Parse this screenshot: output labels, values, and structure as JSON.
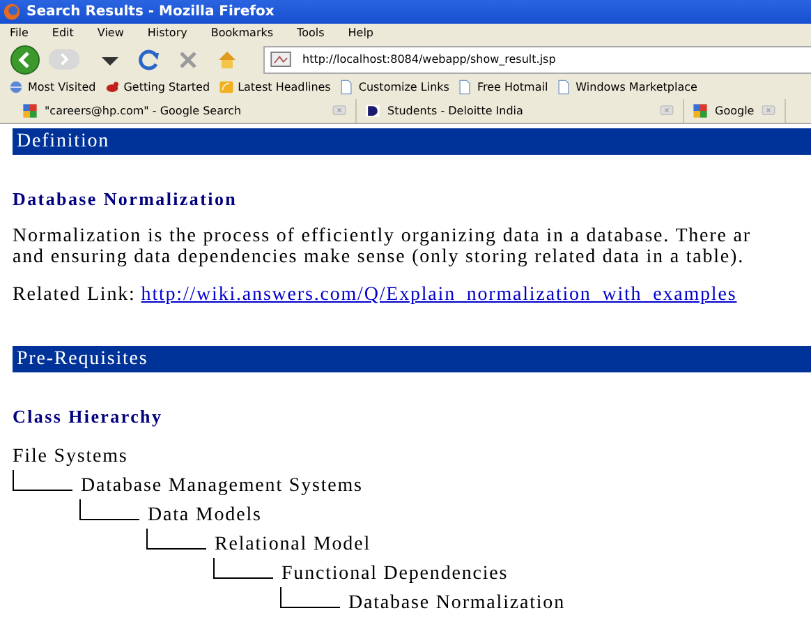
{
  "window": {
    "title": "Search Results - Mozilla Firefox"
  },
  "menu": [
    "File",
    "Edit",
    "View",
    "History",
    "Bookmarks",
    "Tools",
    "Help"
  ],
  "address": {
    "value": "http://localhost:8084/webapp/show_result.jsp"
  },
  "bookmarks": [
    {
      "label": "Most Visited",
      "kind": "globe"
    },
    {
      "label": "Getting Started",
      "kind": "bird"
    },
    {
      "label": "Latest Headlines",
      "kind": "feed"
    },
    {
      "label": "Customize Links",
      "kind": "page"
    },
    {
      "label": "Free Hotmail",
      "kind": "page"
    },
    {
      "label": "Windows Marketplace",
      "kind": "page"
    }
  ],
  "tabs": [
    {
      "label": "\"careers@hp.com\" - Google Search",
      "kind": "google"
    },
    {
      "label": "Students - Deloitte India",
      "kind": "deloitte"
    },
    {
      "label": "Google",
      "kind": "google"
    }
  ],
  "sections": [
    {
      "title": "Definition",
      "heading": "Database Normalization",
      "kind": "text",
      "lines": [
        "Normalization is the process of efficiently organizing data in a database. There ar",
        "and ensuring data dependencies make sense (only storing related data in a table)."
      ],
      "link_label": "Related Link:",
      "link": "http://wiki.answers.com/Q/Explain_normalization_with_examples"
    },
    {
      "title": "Pre-Requisites",
      "heading": "Class Hierarchy",
      "kind": "tree",
      "tree": [
        {
          "label": "File Systems",
          "children": [
            {
              "label": "Database Management Systems",
              "children": [
                {
                  "label": "Data Models",
                  "children": [
                    {
                      "label": "Relational Model",
                      "children": [
                        {
                          "label": "Functional Dependencies",
                          "children": [
                            {
                              "label": "Database Normalization"
                            }
                          ]
                        }
                      ]
                    }
                  ]
                }
              ]
            }
          ]
        }
      ]
    }
  ]
}
